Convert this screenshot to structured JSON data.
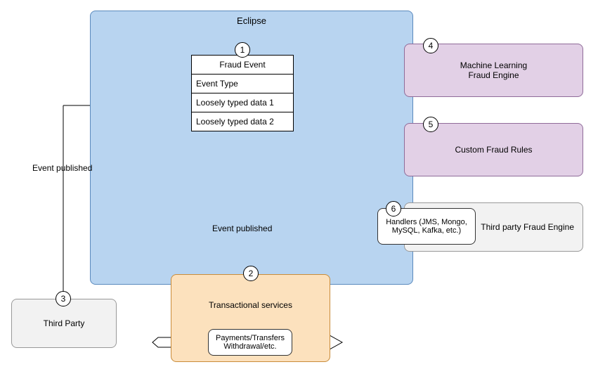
{
  "eclipse": {
    "title": "Eclipse"
  },
  "fraud_event": {
    "title": "Fraud Event",
    "rows": [
      "Event Type",
      "Loosely typed data 1",
      "Loosely typed data 2"
    ]
  },
  "third_party": {
    "label": "Third Party"
  },
  "transactional": {
    "title": "Transactional services",
    "sub": "Payments/Transfers\nWithdrawal/etc."
  },
  "ml_engine": {
    "line1": "Machine Learning",
    "line2": "Fraud Engine"
  },
  "custom_rules": {
    "label": "Custom Fraud Rules"
  },
  "handlers": {
    "label": "Handlers (JMS, Mongo, MySQL, Kafka, etc.)"
  },
  "third_party_engine": {
    "label": "Third party Fraud Engine"
  },
  "labels": {
    "event_published_left": "Event published",
    "event_published_center": "Event published"
  },
  "numbers": {
    "n1": "1",
    "n2": "2",
    "n3": "3",
    "n4": "4",
    "n5": "5",
    "n6": "6"
  }
}
